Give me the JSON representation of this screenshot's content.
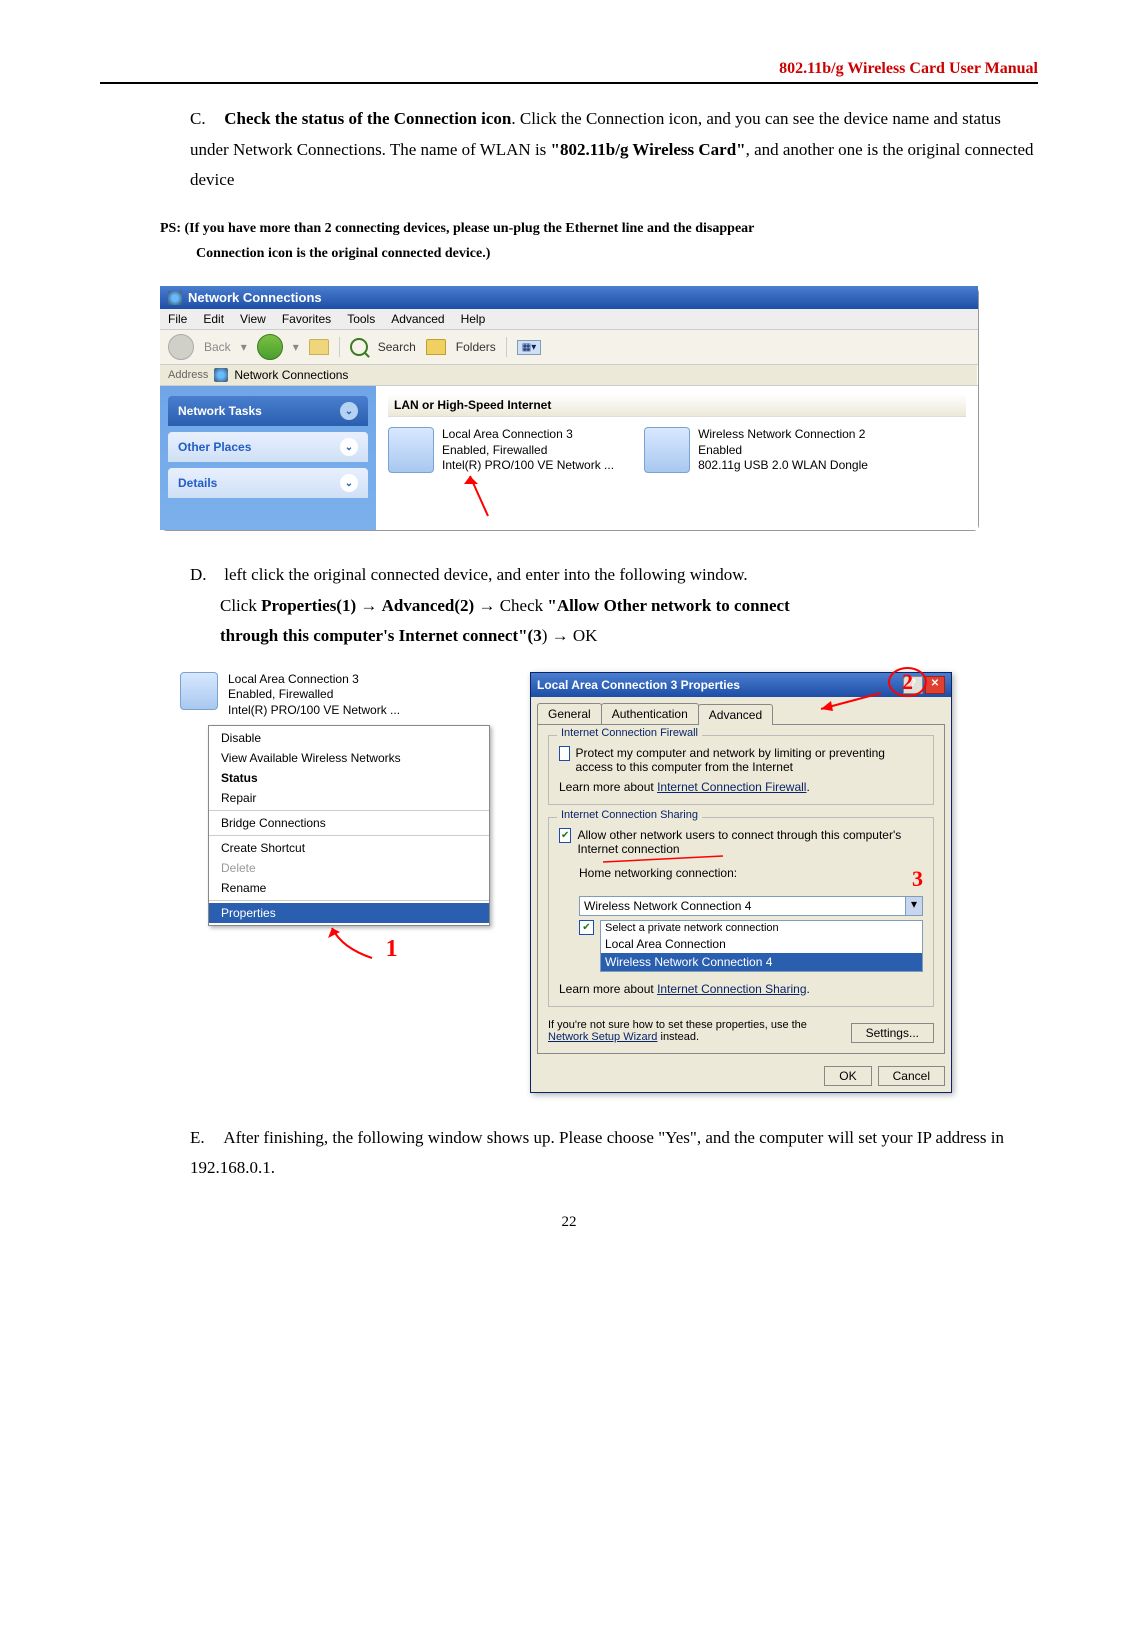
{
  "header": {
    "title": "802.11b/g Wireless Card User Manual"
  },
  "sectionC": {
    "marker": "C.",
    "bold1": "Check the status of the Connection icon",
    "rest1": ". Click the Connection icon, and you can see the device name and status under Network Connections. The name of WLAN is ",
    "bold2": "\"802.11b/g Wireless Card\"",
    "rest2": ", and another one is the original connected device"
  },
  "ps": {
    "line1": "PS: (If you have more than 2 connecting devices, please un-plug the Ethernet line and the disappear ",
    "line2": "Connection icon is the original connected device.)"
  },
  "shot1": {
    "title": "Network Connections",
    "menu": [
      "File",
      "Edit",
      "View",
      "Favorites",
      "Tools",
      "Advanced",
      "Help"
    ],
    "toolbar": {
      "back": "Back",
      "search": "Search",
      "folders": "Folders"
    },
    "address_label": "Address",
    "address_value": "Network Connections",
    "panels": {
      "tasks": "Network Tasks",
      "other": "Other Places",
      "details": "Details"
    },
    "section": "LAN or High-Speed Internet",
    "conn1": {
      "name": "Local Area Connection 3",
      "status": "Enabled, Firewalled",
      "device": "Intel(R) PRO/100 VE Network ..."
    },
    "conn2": {
      "name": "Wireless Network Connection 2",
      "status": "Enabled",
      "device": "802.11g USB 2.0 WLAN Dongle"
    }
  },
  "sectionD": {
    "marker": "D.",
    "line1": "left click the original connected device, and enter into the following window.",
    "line2a": "Click ",
    "p1": "Properties(1)",
    "arrow": " → ",
    "a2": "Advanced(2)",
    "arrow2": " → ",
    "check": "Check ",
    "q1": "\"Allow Other network to connect ",
    "line3": "through this computer's Internet connect\"(3",
    "end": ") → OK"
  },
  "ctx": {
    "head": {
      "name": "Local Area Connection 3",
      "status": "Enabled, Firewalled",
      "device": "Intel(R) PRO/100 VE Network ..."
    },
    "items": [
      {
        "label": "Disable",
        "kind": "item"
      },
      {
        "label": "View Available Wireless Networks",
        "kind": "item"
      },
      {
        "label": "Status",
        "kind": "bold"
      },
      {
        "label": "Repair",
        "kind": "item"
      },
      {
        "label": "",
        "kind": "sep"
      },
      {
        "label": "Bridge Connections",
        "kind": "item"
      },
      {
        "label": "",
        "kind": "sep"
      },
      {
        "label": "Create Shortcut",
        "kind": "item"
      },
      {
        "label": "Delete",
        "kind": "disabled"
      },
      {
        "label": "Rename",
        "kind": "item"
      },
      {
        "label": "",
        "kind": "sep"
      },
      {
        "label": "Properties",
        "kind": "sel"
      }
    ],
    "num1": "1"
  },
  "dlg": {
    "title": "Local Area Connection 3 Properties",
    "tabs": [
      "General",
      "Authentication",
      "Advanced"
    ],
    "group1": {
      "title": "Internet Connection Firewall",
      "chk": "Protect my computer and network by limiting or preventing access to this computer from the Internet",
      "learn": "Learn more about ",
      "link": "Internet Connection Firewall"
    },
    "group2": {
      "title": "Internet Connection Sharing",
      "chk": "Allow other network users to connect through this computer's Internet connection",
      "home_label": "Home networking connection:",
      "combo": "Wireless Network Connection 4",
      "sel_label": "Select a private network connection",
      "lb1": "Local Area Connection",
      "lb2": "Wireless Network Connection 4",
      "learn": "Learn more about ",
      "link": "Internet Connection Sharing"
    },
    "bottom": {
      "text": "If you're not sure how to set these properties, use the ",
      "link": "Network Setup Wizard",
      "after": " instead.",
      "settings": "Settings..."
    },
    "ok": "OK",
    "cancel": "Cancel",
    "num2": "2",
    "num3": "3"
  },
  "sectionE": {
    "marker": "E.",
    "text1": "After finishing, the following window shows up. Please choose ",
    "yes": "\"Yes\"",
    "text2": ", and the computer will set your IP address in 192.168.0.1."
  },
  "pagenum": "22"
}
